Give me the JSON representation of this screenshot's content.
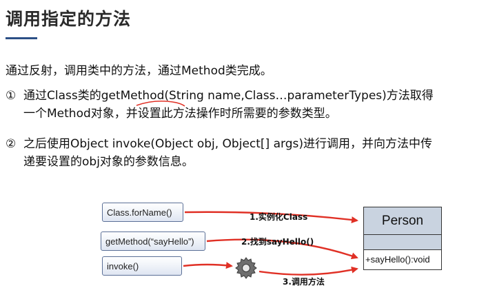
{
  "slide": {
    "title": "调用指定的方法",
    "intro": "通过反射，调用类中的方法，通过Method类完成。",
    "items": [
      {
        "number": "①",
        "line1": "通过Class类的getMethod(String name,Class…parameterTypes)方法取得",
        "line2": "一个Method对象，并设置此方法操作时所需要的参数类型。"
      },
      {
        "number": "②",
        "line1": "之后使用Object invoke(Object obj, Object[] args)进行调用，并向方法中传",
        "line2": "递要设置的obj对象的参数信息。"
      }
    ]
  },
  "diagram": {
    "boxes": {
      "forname": "Class.forName()",
      "getmethod": "getMethod(“sayHello”)",
      "invoke": "invoke()"
    },
    "steps": [
      "1.实例化Class",
      "2.找到sayHello()",
      "3.调用方法"
    ],
    "person_class": {
      "name": "Person",
      "method": "+sayHello():void"
    },
    "colors": {
      "arrow": "#e03025",
      "box_border": "#5a6f96",
      "person_fill": "#c9d3e0",
      "title_underline": "#2c4f86"
    },
    "icons": [
      "gear-icon"
    ]
  }
}
